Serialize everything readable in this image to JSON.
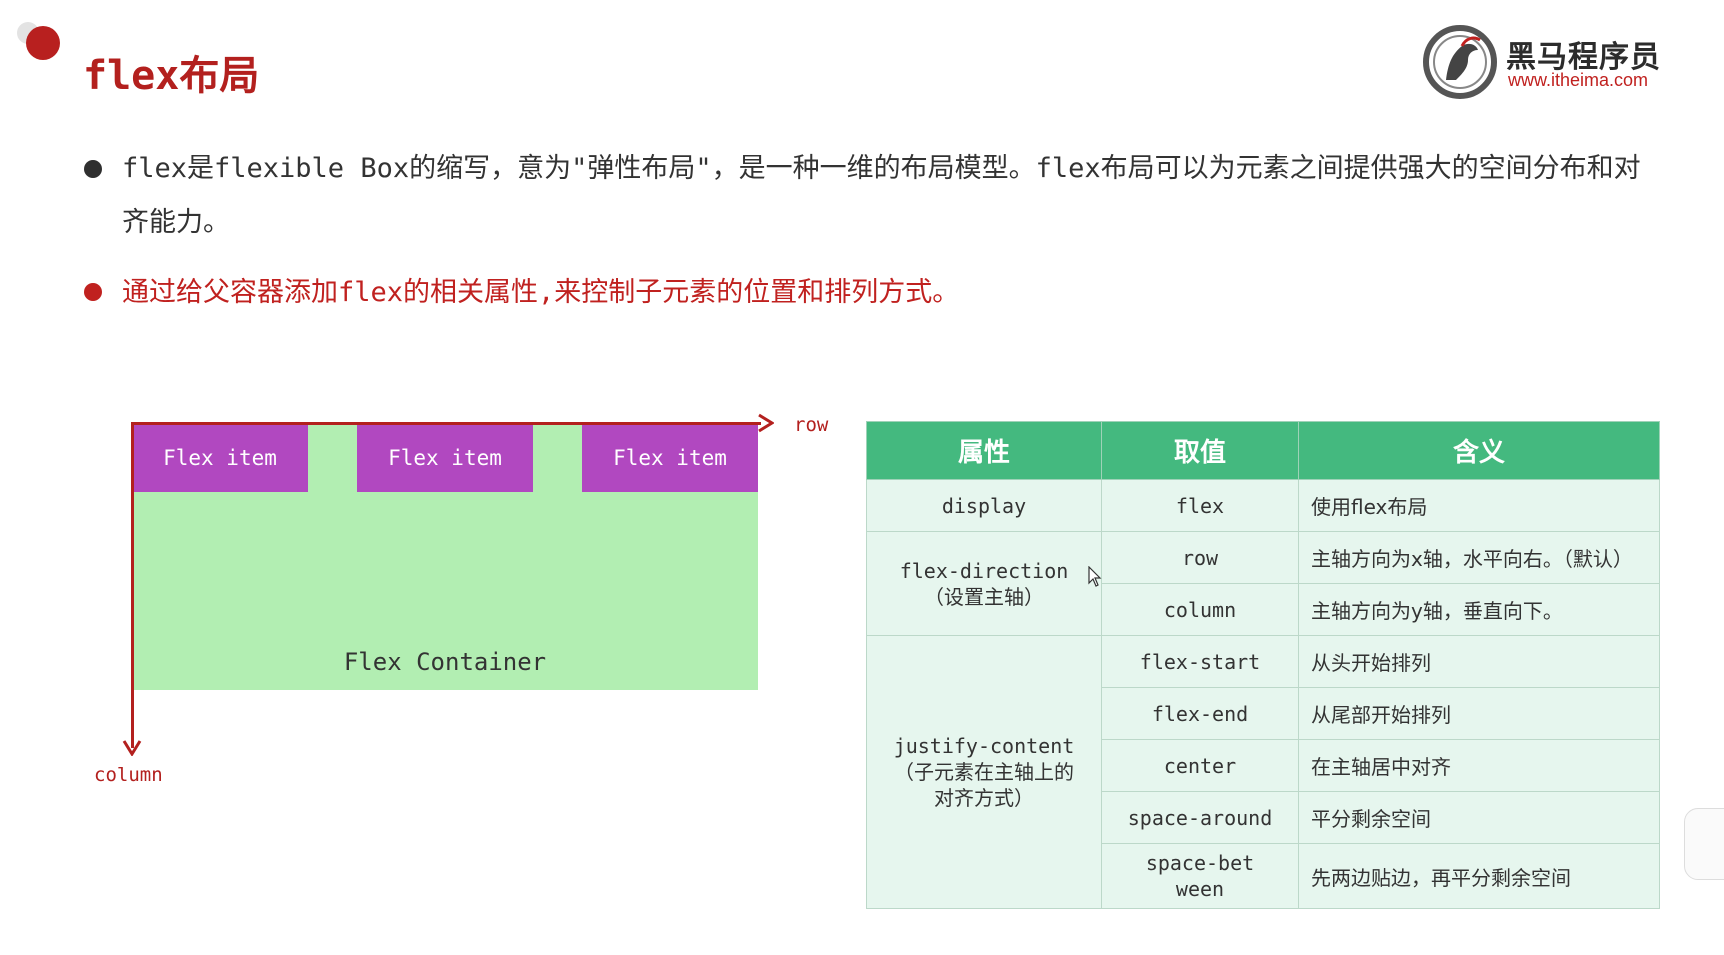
{
  "header": {
    "title": "flex布局",
    "logo_name": "黑马程序员",
    "logo_url": "www.itheima.com"
  },
  "bullets": [
    "flex是flexible Box的缩写，意为\"弹性布局\"，是一种一维的布局模型。flex布局可以为元素之间提供强大的空间分布和对齐能力。",
    "通过给父容器添加flex的相关属性,来控制子元素的位置和排列方式。"
  ],
  "diagram": {
    "items": [
      "Flex item",
      "Flex item",
      "Flex item"
    ],
    "container_label": "Flex Container",
    "axis_row": "row",
    "axis_column": "column"
  },
  "table": {
    "headers": [
      "属性",
      "取值",
      "含义"
    ],
    "groups": [
      {
        "property": "display",
        "property_note": "",
        "rows": [
          {
            "value": "flex",
            "meaning": "使用flex布局"
          }
        ]
      },
      {
        "property": "flex-direction",
        "property_note": "（设置主轴）",
        "rows": [
          {
            "value": "row",
            "meaning": "主轴方向为x轴，水平向右。（默认）"
          },
          {
            "value": "column",
            "meaning": "主轴方向为y轴，垂直向下。"
          }
        ]
      },
      {
        "property": "justify-content",
        "property_note": "（子元素在主轴上的对齐方式）",
        "rows": [
          {
            "value": "flex-start",
            "meaning": "从头开始排列"
          },
          {
            "value": "flex-end",
            "meaning": "从尾部开始排列"
          },
          {
            "value": "center",
            "meaning": "在主轴居中对齐"
          },
          {
            "value": "space-around",
            "meaning": "平分剩余空间"
          },
          {
            "value": "space-between",
            "meaning": "先两边贴边，再平分剩余空间"
          }
        ]
      }
    ]
  },
  "colors": {
    "accent_red": "#b3201e",
    "table_header": "#44b97f",
    "table_body": "#e6f6ee",
    "flex_item": "#b148c0",
    "flex_container": "#b2eeb2"
  }
}
